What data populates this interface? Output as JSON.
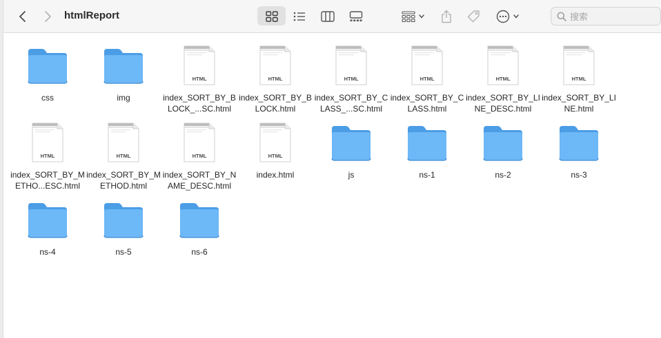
{
  "window": {
    "title": "htmlReport"
  },
  "toolbar": {
    "back_icon": "chevron-left-icon",
    "forward_icon": "chevron-right-icon",
    "views": [
      {
        "name": "icon-view",
        "selected": true
      },
      {
        "name": "list-view",
        "selected": false
      },
      {
        "name": "column-view",
        "selected": false
      },
      {
        "name": "gallery-view",
        "selected": false
      }
    ],
    "group_icon": "group-grid-icon",
    "share_icon": "share-icon",
    "tag_icon": "tag-icon",
    "more_icon": "ellipsis-circle-icon"
  },
  "search": {
    "placeholder": "搜索"
  },
  "colors": {
    "folder_front": "#6db8f6",
    "folder_back": "#4b9de6",
    "toolbar_bg": "#f6f6f6",
    "selected_view_bg": "#e1e1e1"
  },
  "files": [
    {
      "name": "css",
      "type": "folder"
    },
    {
      "name": "img",
      "type": "folder"
    },
    {
      "name": "index_SORT_BY_BLOCK_...SC.html",
      "type": "html",
      "badge": "HTML"
    },
    {
      "name": "index_SORT_BY_BLOCK.html",
      "type": "html",
      "badge": "HTML"
    },
    {
      "name": "index_SORT_BY_CLASS_...SC.html",
      "type": "html",
      "badge": "HTML"
    },
    {
      "name": "index_SORT_BY_CLASS.html",
      "type": "html",
      "badge": "HTML"
    },
    {
      "name": "index_SORT_BY_LINE_DESC.html",
      "type": "html",
      "badge": "HTML"
    },
    {
      "name": "index_SORT_BY_LINE.html",
      "type": "html",
      "badge": "HTML"
    },
    {
      "name": "index_SORT_BY_METHO...ESC.html",
      "type": "html",
      "badge": "HTML"
    },
    {
      "name": "index_SORT_BY_METHOD.html",
      "type": "html",
      "badge": "HTML"
    },
    {
      "name": "index_SORT_BY_NAME_DESC.html",
      "type": "html",
      "badge": "HTML"
    },
    {
      "name": "index.html",
      "type": "html",
      "badge": "HTML"
    },
    {
      "name": "js",
      "type": "folder"
    },
    {
      "name": "ns-1",
      "type": "folder"
    },
    {
      "name": "ns-2",
      "type": "folder"
    },
    {
      "name": "ns-3",
      "type": "folder"
    },
    {
      "name": "ns-4",
      "type": "folder"
    },
    {
      "name": "ns-5",
      "type": "folder"
    },
    {
      "name": "ns-6",
      "type": "folder"
    }
  ]
}
